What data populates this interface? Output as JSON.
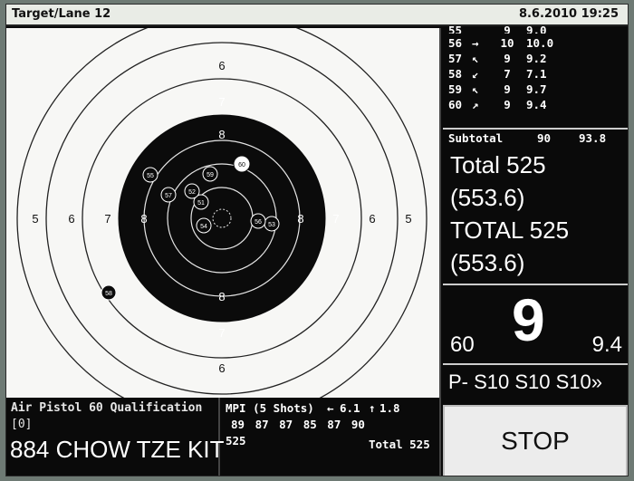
{
  "header": {
    "title": "Target/Lane 12",
    "datetime": "8.6.2010 19:25"
  },
  "target": {
    "ring_labels": {
      "r5": "5",
      "r6": "6",
      "r7": "7",
      "r8": "8"
    },
    "shots": [
      {
        "id": "60",
        "score": 9.4,
        "highlight": true
      },
      {
        "id": "59",
        "score": 9.7
      },
      {
        "id": "58",
        "score": 7.1
      },
      {
        "id": "57",
        "score": 9.2
      },
      {
        "id": "56",
        "score": 10.0
      },
      {
        "id": "55",
        "score": 9.0
      },
      {
        "id": "54",
        "score": 10.0
      },
      {
        "id": "53",
        "score": 9.8
      },
      {
        "id": "52",
        "score": 10.1
      },
      {
        "id": "51",
        "score": 10.3
      }
    ]
  },
  "shot_list": {
    "partial": {
      "n": "55",
      "s": "9",
      "d": "9.0"
    },
    "rows": [
      {
        "n": "56",
        "arrow": "→",
        "s": "10",
        "d": "10.0"
      },
      {
        "n": "57",
        "arrow": "↖",
        "s": "9",
        "d": "9.2"
      },
      {
        "n": "58",
        "arrow": "↙",
        "s": "7",
        "d": "7.1"
      },
      {
        "n": "59",
        "arrow": "↖",
        "s": "9",
        "d": "9.7"
      },
      {
        "n": "60",
        "arrow": "↗",
        "s": "9",
        "d": "9.4"
      }
    ],
    "subtotal_label": "Subtotal",
    "subtotal_int": "90",
    "subtotal_dec": "93.8"
  },
  "totals": {
    "total1": "Total  525",
    "total1_dec": "(553.6)",
    "total2": "TOTAL 525",
    "total2_dec": "(553.6)"
  },
  "current": {
    "shot_no": "60",
    "score": "9",
    "decimal": "9.4"
  },
  "series": "P- S10 S10 S10»",
  "match": {
    "name": "Air Pistol 60 Qualification",
    "code": "[0]",
    "shooter": "884 CHOW TZE KIT"
  },
  "mpi": {
    "label": "MPI (5 Shots)",
    "x_arrow": "←",
    "x_val": "6.1",
    "y_arrow": "↑",
    "y_val": "1.8",
    "series_scores": "89 87 87 85 87 90",
    "running": "525",
    "total": "Total 525"
  },
  "stop_label": "STOP",
  "colors": {
    "target_black": "#0b0b0b",
    "target_white": "#f7f7f5",
    "screen_bg": "#0a0a0a"
  }
}
